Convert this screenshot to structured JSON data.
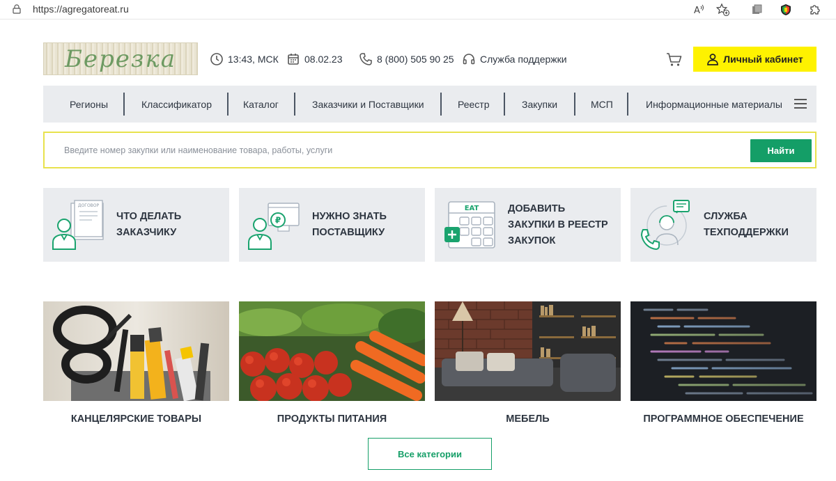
{
  "browser": {
    "url": "https://agregatoreat.ru"
  },
  "header": {
    "logo_text": "Березка",
    "time": "13:43, МСК",
    "date": "08.02.23",
    "phone": "8 (800) 505 90 25",
    "support": "Служба поддержки",
    "cabinet_label": "Личный кабинет"
  },
  "nav": {
    "items": [
      {
        "label": "Регионы"
      },
      {
        "label": "Классификатор"
      },
      {
        "label": "Каталог"
      },
      {
        "label": "Заказчики и Поставщики"
      },
      {
        "label": "Реестр"
      },
      {
        "label": "Закупки"
      },
      {
        "label": "МСП"
      },
      {
        "label": "Информационные материалы"
      }
    ]
  },
  "search": {
    "placeholder": "Введите номер закупки или наименование товара, работы, услуги",
    "button_label": "Найти"
  },
  "tiles": [
    {
      "line1": "ЧТО ДЕЛАТЬ",
      "line2": "ЗАКАЗЧИКУ",
      "icon_text": "ДОГОВОР"
    },
    {
      "line1": "НУЖНО ЗНАТЬ",
      "line2": "ПОСТАВЩИКУ"
    },
    {
      "line1": "ДОБАВИТЬ",
      "line2": "ЗАКУПКИ В РЕЕСТР",
      "line3": "ЗАКУПОК",
      "icon_text": "EAT"
    },
    {
      "line1": "СЛУЖБА",
      "line2": "ТЕХПОДДЕРЖКИ"
    }
  ],
  "categories": [
    {
      "label": "КАНЦЕЛЯРСКИЕ ТОВАРЫ"
    },
    {
      "label": "ПРОДУКТЫ ПИТАНИЯ"
    },
    {
      "label": "МЕБЕЛЬ"
    },
    {
      "label": "ПРОГРАММНОЕ ОБЕСПЕЧЕНИЕ"
    }
  ],
  "all_categories_label": "Все категории",
  "colors": {
    "accent_green": "#149e67",
    "yellow": "#fef200",
    "panel_gray": "#eaecef",
    "text": "#2d3540"
  }
}
